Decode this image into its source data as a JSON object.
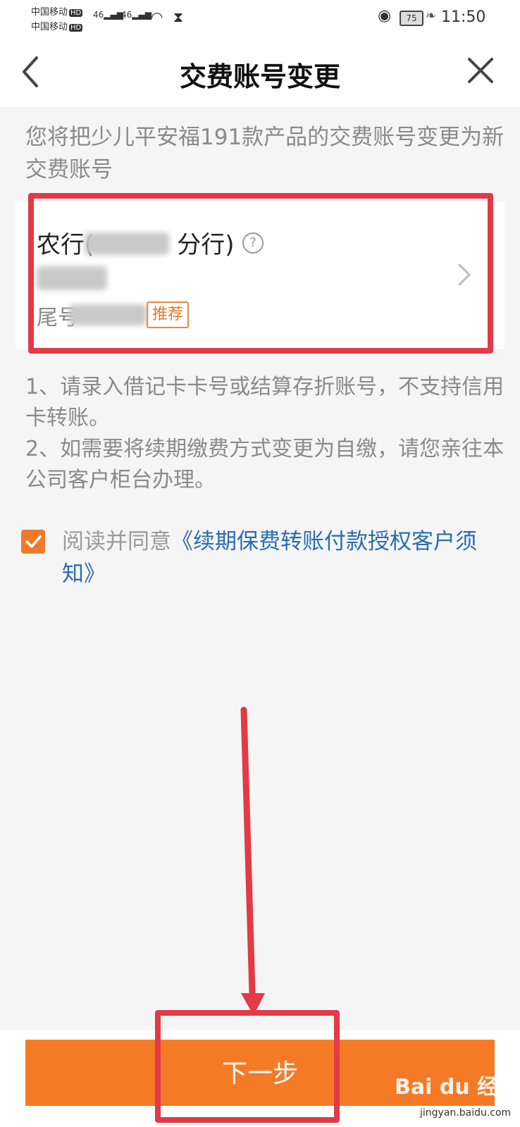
{
  "status_bar": {
    "carrier1": "中国移动",
    "carrier2": "中国移动",
    "hd": "HD",
    "signal1": "46",
    "signal2": "46",
    "battery": "75",
    "time": "11:50"
  },
  "nav": {
    "title": "交费账号变更"
  },
  "intro": "您将把少儿平安福191款产品的交费账号变更为新交费账号",
  "card": {
    "bank_prefix": "农行(",
    "bank_suffix": "分行)",
    "help": "?",
    "tail_prefix": "尾号",
    "tag": "推荐"
  },
  "notes": [
    "1、请录入借记卡卡号或结算存折账号，不支持信用卡转账。",
    "2、如需要将续期缴费方式变更为自缴，请您亲往本公司客户柜台办理。"
  ],
  "agreement": {
    "prefix": "阅读并同意",
    "link": "《续期保费转账付款授权客户须知》",
    "checked": true
  },
  "bottom": {
    "next_label": "下一步"
  },
  "watermark": {
    "logo": "Bai du 经验",
    "url": "jingyan.baidu.com"
  },
  "colors": {
    "accent": "#f57a26",
    "annotation": "#e23a46",
    "link": "#2b6cb0"
  }
}
